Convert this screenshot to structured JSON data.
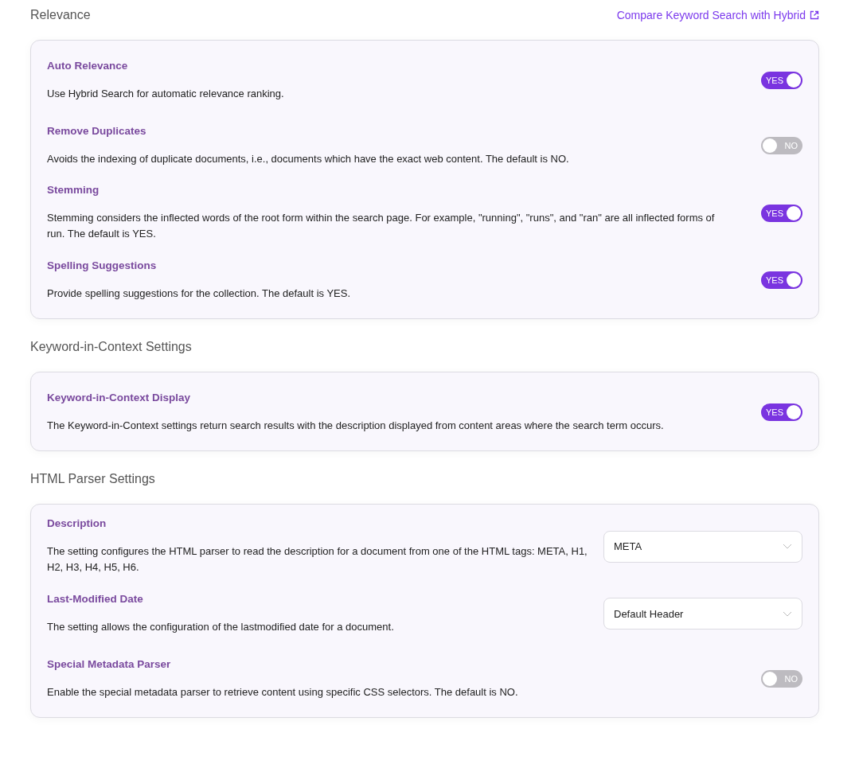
{
  "sections": [
    {
      "title": "Relevance",
      "link": "Compare Keyword Search with Hybrid",
      "items": [
        {
          "kind": "toggle",
          "title": "Auto Relevance",
          "description": "Use Hybrid Search for automatic relevance ranking.",
          "on": true,
          "label": "YES"
        },
        {
          "kind": "toggle",
          "title": "Remove Duplicates",
          "description": "Avoids the indexing of duplicate documents, i.e., documents which have the exact web content. The default is NO.",
          "on": false,
          "label": "NO"
        },
        {
          "kind": "toggle",
          "title": "Stemming",
          "description": "Stemming considers the inflected words of the root form within the search page. For example, \"running\", \"runs\", and \"ran\" are all inflected forms of run. The default is YES.",
          "on": true,
          "label": "YES"
        },
        {
          "kind": "toggle",
          "title": "Spelling Suggestions",
          "description": "Provide spelling suggestions for the collection. The default is YES.",
          "on": true,
          "label": "YES"
        }
      ]
    },
    {
      "title": "Keyword-in-Context Settings",
      "items": [
        {
          "kind": "toggle",
          "title": "Keyword-in-Context Display",
          "description": "The Keyword-in-Context settings return search results with the description displayed from content areas where the search term occurs.",
          "on": true,
          "label": "YES"
        }
      ]
    },
    {
      "title": "HTML Parser Settings",
      "items": [
        {
          "kind": "select",
          "title": "Description",
          "description": "The setting configures the HTML parser to read the description for a document from one of the HTML tags: META, H1, H2, H3, H4, H5, H6.",
          "value": "META"
        },
        {
          "kind": "select",
          "title": "Last-Modified Date",
          "description": "The setting allows the configuration of the lastmodified date for a document.",
          "value": "Default Header"
        },
        {
          "kind": "toggle",
          "title": "Special Metadata Parser",
          "description": "Enable the special metadata parser to retrieve content using specific CSS selectors. The default is NO.",
          "on": false,
          "label": "NO"
        }
      ]
    }
  ]
}
